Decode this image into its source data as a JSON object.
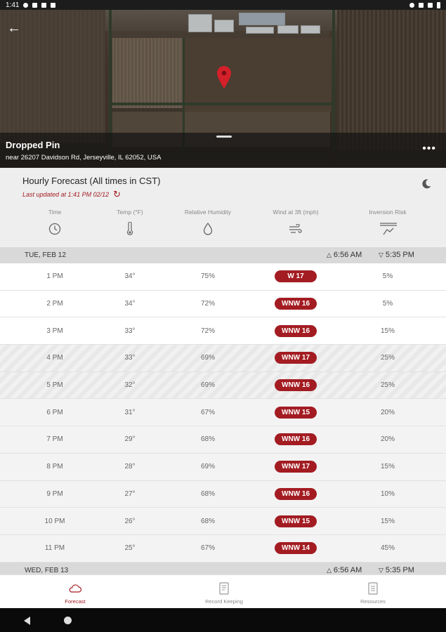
{
  "status_bar": {
    "time": "1:41"
  },
  "location": {
    "title": "Dropped Pin",
    "address": "near 26207 Davidson Rd, Jerseyville, IL 62052, USA"
  },
  "forecast": {
    "title": "Hourly Forecast (All times in CST)",
    "updated": "Last updated at 1:41 PM 02/12",
    "columns": [
      {
        "label": "Time",
        "icon": "clock-icon"
      },
      {
        "label": "Temp (°F)",
        "icon": "thermometer-icon"
      },
      {
        "label": "Relative Humidity",
        "icon": "droplet-icon"
      },
      {
        "label": "Wind at 3ft (mph)",
        "icon": "wind-icon"
      },
      {
        "label": "Inversion Risk",
        "icon": "inversion-icon"
      }
    ],
    "accent": "#a31c22"
  },
  "days": [
    {
      "date": "TUE, FEB 12",
      "sunrise": "6:56 AM",
      "sunset": "5:35 PM"
    },
    {
      "date": "WED, FEB 13",
      "sunrise": "6:56 AM",
      "sunset": "5:35 PM"
    }
  ],
  "rows": [
    {
      "time": "1 PM",
      "temp": "34°",
      "humidity": "75%",
      "wind": "W 17",
      "risk": "5%",
      "style": "day"
    },
    {
      "time": "2 PM",
      "temp": "34°",
      "humidity": "72%",
      "wind": "WNW 16",
      "risk": "5%",
      "style": "day"
    },
    {
      "time": "3 PM",
      "temp": "33°",
      "humidity": "72%",
      "wind": "WNW 16",
      "risk": "15%",
      "style": "day"
    },
    {
      "time": "4 PM",
      "temp": "33°",
      "humidity": "69%",
      "wind": "WNW 17",
      "risk": "25%",
      "style": "hatched"
    },
    {
      "time": "5 PM",
      "temp": "32°",
      "humidity": "69%",
      "wind": "WNW 16",
      "risk": "25%",
      "style": "hatched"
    },
    {
      "time": "6 PM",
      "temp": "31°",
      "humidity": "67%",
      "wind": "WNW 15",
      "risk": "20%",
      "style": "grey"
    },
    {
      "time": "7 PM",
      "temp": "29°",
      "humidity": "68%",
      "wind": "WNW 16",
      "risk": "20%",
      "style": "grey"
    },
    {
      "time": "8 PM",
      "temp": "28°",
      "humidity": "69%",
      "wind": "WNW 17",
      "risk": "15%",
      "style": "grey"
    },
    {
      "time": "9 PM",
      "temp": "27°",
      "humidity": "68%",
      "wind": "WNW 16",
      "risk": "10%",
      "style": "grey"
    },
    {
      "time": "10 PM",
      "temp": "26°",
      "humidity": "68%",
      "wind": "WNW 15",
      "risk": "15%",
      "style": "grey"
    },
    {
      "time": "11 PM",
      "temp": "25°",
      "humidity": "67%",
      "wind": "WNW 14",
      "risk": "45%",
      "style": "grey"
    }
  ],
  "bottom_nav": [
    {
      "label": "Forecast",
      "icon": "cloud-icon",
      "active": true
    },
    {
      "label": "Record Keeping",
      "icon": "notebook-icon",
      "active": false
    },
    {
      "label": "Resources",
      "icon": "document-icon",
      "active": false
    }
  ]
}
